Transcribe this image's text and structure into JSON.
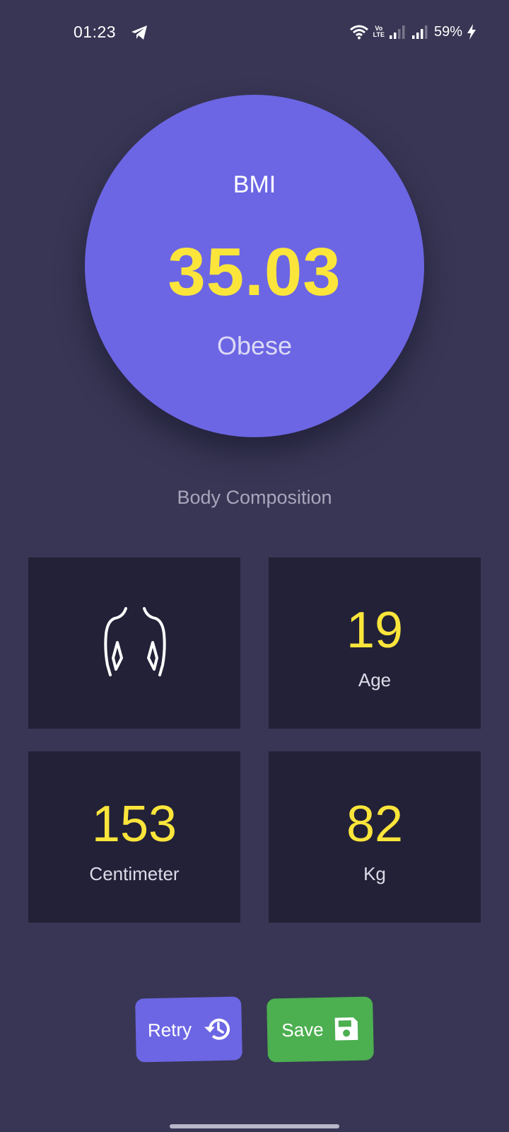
{
  "status_bar": {
    "time": "01:23",
    "battery": "59%",
    "volte_top": "Vo",
    "volte_bottom": "LTE"
  },
  "result": {
    "label": "BMI",
    "value": "35.03",
    "category": "Obese"
  },
  "section_title": "Body Composition",
  "cards": {
    "gender": {
      "icon": "gender-male-icon"
    },
    "age": {
      "value": "19",
      "label": "Age"
    },
    "height": {
      "value": "153",
      "label": "Centimeter"
    },
    "weight": {
      "value": "82",
      "label": "Kg"
    }
  },
  "actions": {
    "retry_label": "Retry",
    "retry_icon": "history-icon",
    "save_label": "Save",
    "save_icon": "floppy-disk-icon"
  },
  "colors": {
    "background": "#383654",
    "accent": "#6c66e4",
    "highlight": "#fbe53b",
    "card": "#222137",
    "save": "#4caf50"
  }
}
